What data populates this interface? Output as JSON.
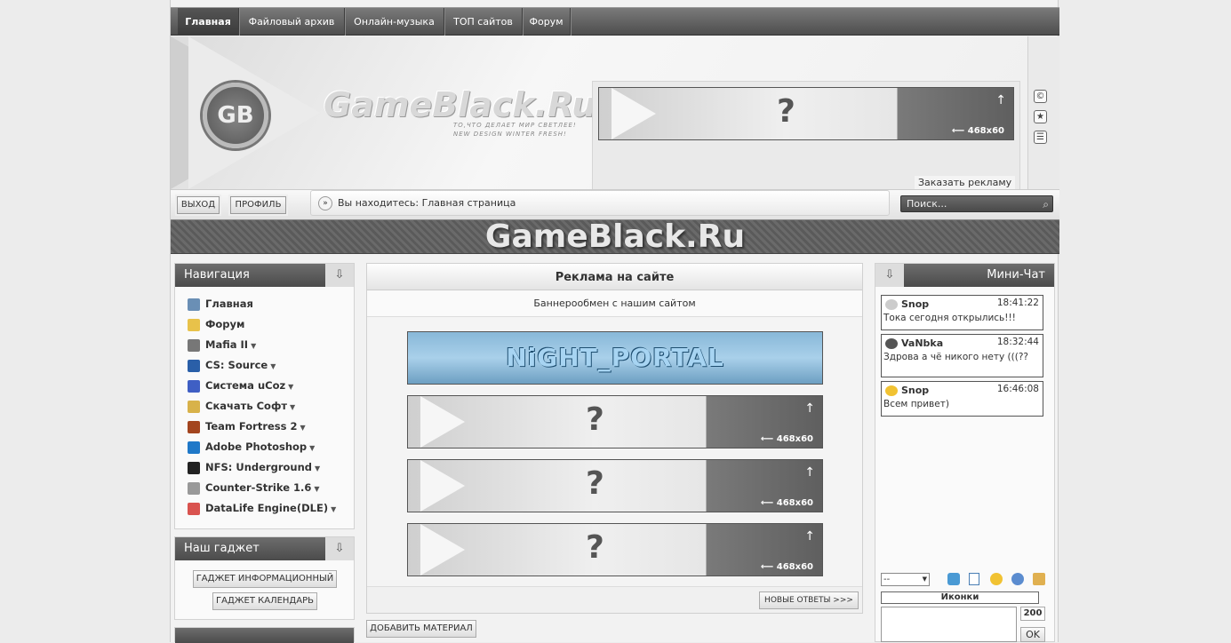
{
  "topnav": [
    "Главная",
    "Файловый архив",
    "Онлайн-музыка",
    "ТОП сайтов",
    "Форум"
  ],
  "header": {
    "logo_badge": "GB",
    "logo_text": "GameBlack.Ru",
    "slogan_line1": "ТО,ЧТО ДЕЛАЕТ МИР СВЕТЛЕЕ!",
    "slogan_line2": "NEW DESIGN WINTER FRESH!",
    "banner_size": "468x60",
    "banner_q": "?",
    "order_ad": "Заказать рекламу",
    "icons": [
      "copyright-icon",
      "star-icon",
      "rss-icon"
    ]
  },
  "subbar": {
    "logout": "ВЫХОД",
    "profile": "ПРОФИЛЬ",
    "breadcrumb": "Вы находитесь: Главная страница",
    "search_placeholder": "Поиск..."
  },
  "brand": "GameBlack.Ru",
  "nav": {
    "title": "Навигация",
    "items": [
      {
        "label": "Главная",
        "dd": false,
        "color": "#6a8fb5"
      },
      {
        "label": "Форум",
        "dd": false,
        "color": "#e8c24a"
      },
      {
        "label": "Mafia II",
        "dd": true,
        "color": "#777777"
      },
      {
        "label": "CS: Source",
        "dd": true,
        "color": "#2a5fa8"
      },
      {
        "label": "Система uCoz",
        "dd": true,
        "color": "#3f5fc4"
      },
      {
        "label": "Скачать Софт",
        "dd": true,
        "color": "#d8b24a"
      },
      {
        "label": "Team Fortress 2",
        "dd": true,
        "color": "#a3451f"
      },
      {
        "label": "Adobe Photoshop",
        "dd": true,
        "color": "#1f78c8"
      },
      {
        "label": "NFS: Underground",
        "dd": true,
        "color": "#222222"
      },
      {
        "label": "Counter-Strike 1.6",
        "dd": true,
        "color": "#999999"
      },
      {
        "label": "DataLife Engine(DLE)",
        "dd": true,
        "color": "#d9534f"
      }
    ]
  },
  "gadget": {
    "title": "Наш гаджет",
    "btn1": "ГАДЖЕТ ИНФОРМАЦИОННЫЙ",
    "btn2": "ГАДЖЕТ КАЛЕНДАРЬ"
  },
  "center": {
    "title": "Реклама на сайте",
    "subtitle": "Баннерообмен с нашим сайтом",
    "night_banner": "NiGHT_PORTAL",
    "banner_size": "468x60",
    "banner_q": "?",
    "new_answers": "НОВЫЕ ОТВЕТЫ >>>",
    "add_material": "ДОБАВИТЬ МАТЕРИАЛ"
  },
  "chat": {
    "title": "Мини-Чат",
    "messages": [
      {
        "nick": "Snop",
        "time": "18:41:22",
        "text": "Тока сегодня открылись!!!"
      },
      {
        "nick": "VaNbka",
        "time": "18:32:44",
        "text": "Здрова а чё никого нету (((??"
      },
      {
        "nick": "Snop",
        "time": "16:46:08",
        "text": "Всем привет)"
      }
    ],
    "select_value": "--",
    "icons_label": "Иконки",
    "counter": "200",
    "ok": "OK"
  }
}
